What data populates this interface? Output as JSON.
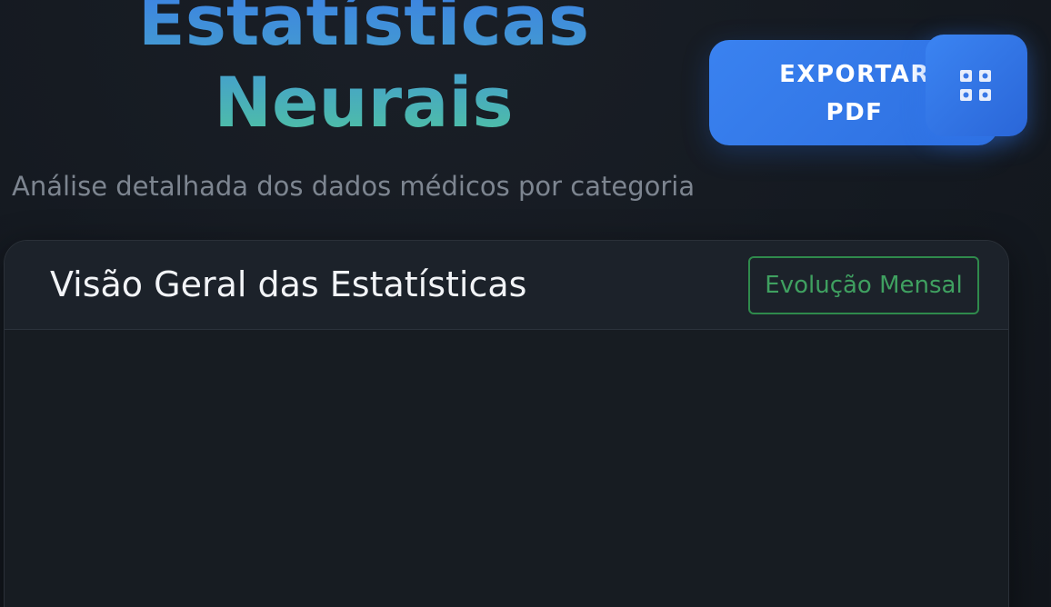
{
  "header": {
    "title": "Estatísticas Neurais",
    "subtitle": "Análise detalhada dos dados médicos por categoria"
  },
  "actions": {
    "export_label": "EXPORTAR PDF",
    "grid_icon": "grid-icon"
  },
  "overview_card": {
    "title": "Visão Geral das Estatísticas",
    "trend_button_label": "Evolução Mensal"
  },
  "colors": {
    "background": "#141920",
    "accent_blue": "#3a82f0",
    "accent_green": "#3fa060",
    "title_gradient_start": "#3b7fe6",
    "title_gradient_end": "#4fc3a0"
  }
}
